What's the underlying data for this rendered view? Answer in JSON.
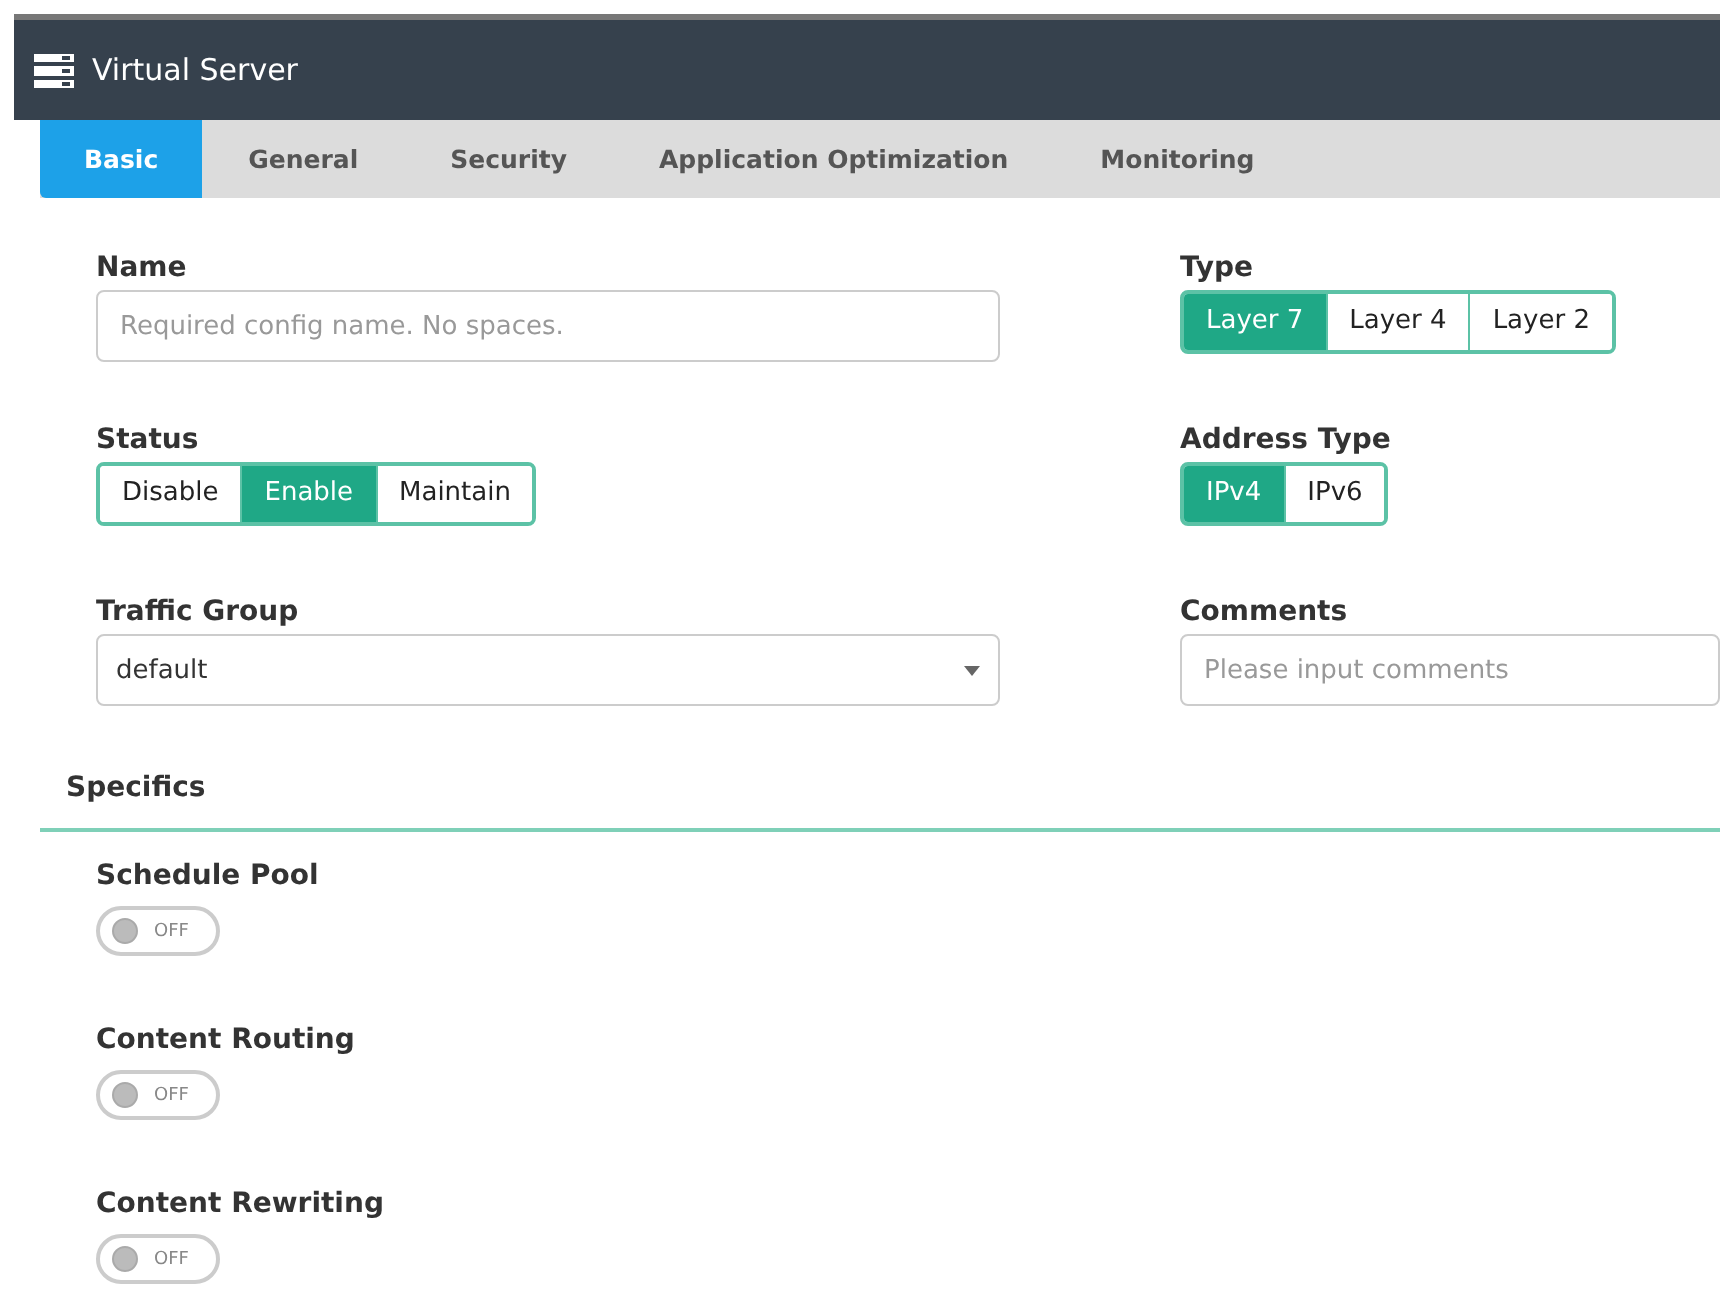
{
  "window": {
    "title": "Virtual Server"
  },
  "tabs": [
    {
      "label": "Basic",
      "selected": true
    },
    {
      "label": "General",
      "selected": false
    },
    {
      "label": "Security",
      "selected": false
    },
    {
      "label": "Application Optimization",
      "selected": false
    },
    {
      "label": "Monitoring",
      "selected": false
    }
  ],
  "left_fields": [
    {
      "kind": "text",
      "label": "Name",
      "placeholder": "Required config name. No spaces."
    },
    {
      "kind": "segmented",
      "label": "Status",
      "options": [
        {
          "label": "Disable",
          "selected": false
        },
        {
          "label": "Enable",
          "selected": true
        },
        {
          "label": "Maintain",
          "selected": false
        }
      ]
    },
    {
      "kind": "select",
      "label": "Traffic Group",
      "value": "default"
    }
  ],
  "right_fields": [
    {
      "kind": "segmented",
      "label": "Type",
      "options": [
        {
          "label": "Layer 7",
          "selected": true
        },
        {
          "label": "Layer 4",
          "selected": false
        },
        {
          "label": "Layer 2",
          "selected": false
        }
      ]
    },
    {
      "kind": "segmented",
      "label": "Address Type",
      "options": [
        {
          "label": "IPv4",
          "selected": true
        },
        {
          "label": "IPv6",
          "selected": false
        }
      ]
    },
    {
      "kind": "text",
      "label": "Comments",
      "placeholder": "Please input comments"
    }
  ],
  "specifics": {
    "title": "Specifics",
    "toggles": [
      {
        "label": "Schedule Pool",
        "on": false,
        "state_text": "OFF"
      },
      {
        "label": "Content Routing",
        "on": false,
        "state_text": "OFF"
      },
      {
        "label": "Content Rewriting",
        "on": false,
        "state_text": "OFF"
      }
    ]
  }
}
